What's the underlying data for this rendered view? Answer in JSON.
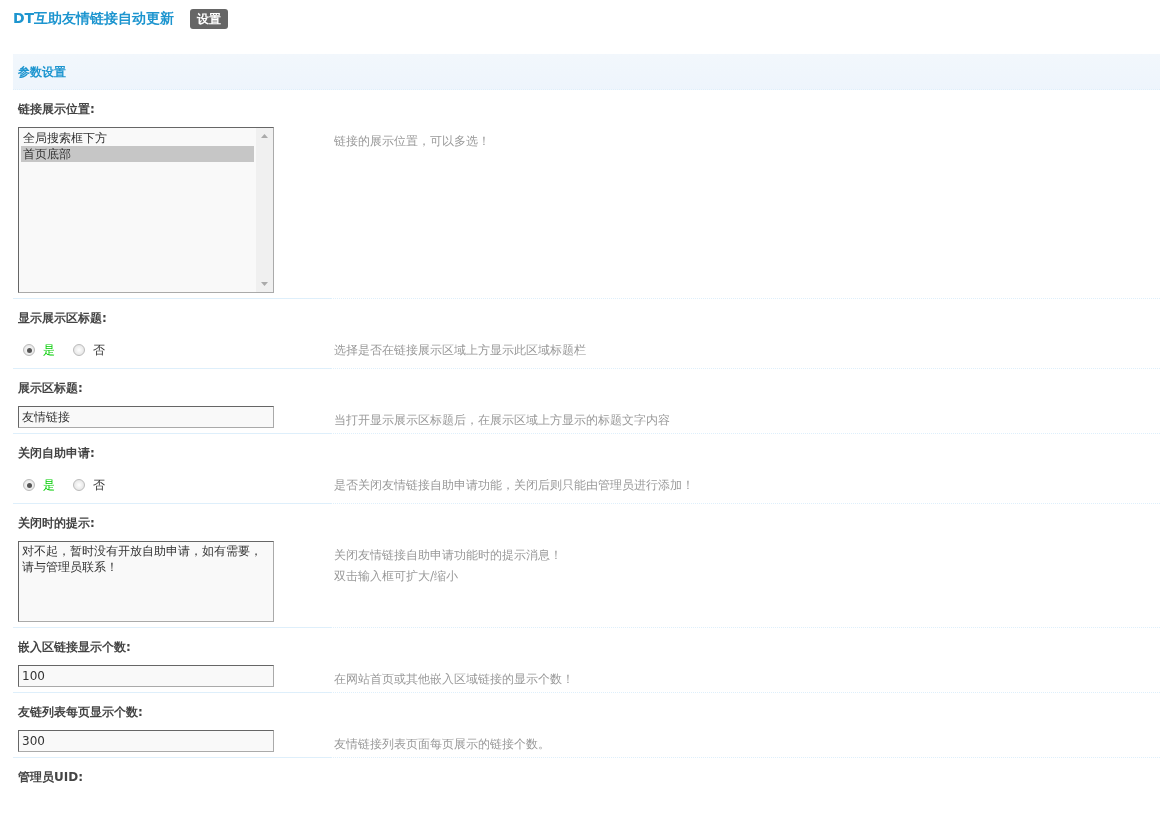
{
  "header": {
    "title": "DT互助友情链接自动更新",
    "badge": "设置"
  },
  "section": {
    "title": "参数设置"
  },
  "settings": [
    {
      "kind": "multiselect",
      "label": "链接展示位置:",
      "options": [
        {
          "text": "全局搜索框下方",
          "selected": false
        },
        {
          "text": "首页底部",
          "selected": true
        }
      ],
      "description": [
        "链接的展示位置，可以多选！"
      ]
    },
    {
      "kind": "radio",
      "label": "显示展示区标题:",
      "options": [
        {
          "text": "是",
          "selected": true
        },
        {
          "text": "否",
          "selected": false
        }
      ],
      "description": [
        "选择是否在链接展示区域上方显示此区域标题栏"
      ]
    },
    {
      "kind": "text",
      "label": "展示区标题:",
      "value": "友情链接",
      "description": [
        "当打开显示展示区标题后，在展示区域上方显示的标题文字内容"
      ]
    },
    {
      "kind": "radio",
      "label": "关闭自助申请:",
      "options": [
        {
          "text": "是",
          "selected": true
        },
        {
          "text": "否",
          "selected": false
        }
      ],
      "description": [
        "是否关闭友情链接自助申请功能，关闭后则只能由管理员进行添加！"
      ]
    },
    {
      "kind": "textarea",
      "label": "关闭时的提示:",
      "value": "对不起，暂时没有开放自助申请，如有需要，请与管理员联系！",
      "description": [
        "关闭友情链接自助申请功能时的提示消息！",
        "双击输入框可扩大/缩小"
      ]
    },
    {
      "kind": "text",
      "label": "嵌入区链接显示个数:",
      "value": "100",
      "description": [
        "在网站首页或其他嵌入区域链接的显示个数！"
      ]
    },
    {
      "kind": "text",
      "label": "友链列表每页显示个数:",
      "value": "300",
      "description": [
        "友情链接列表页面每页展示的链接个数。"
      ]
    },
    {
      "kind": "label_only",
      "label": "管理员UID:"
    }
  ]
}
